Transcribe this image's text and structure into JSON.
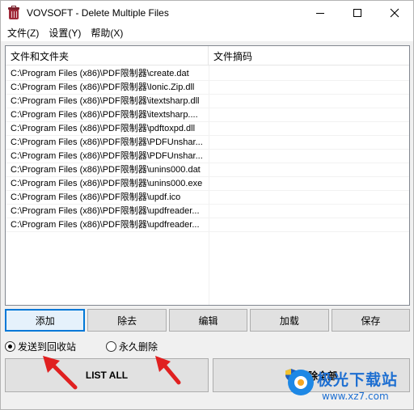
{
  "window": {
    "title": "VOVSOFT - Delete Multiple Files"
  },
  "menu": {
    "items": [
      "文件(Z)",
      "设置(Y)",
      "帮助(X)"
    ]
  },
  "list": {
    "columns": [
      "文件和文件夹",
      "文件摘码"
    ],
    "rows": [
      [
        "C:\\Program Files (x86)\\PDF限制器\\create.dat",
        ""
      ],
      [
        "C:\\Program Files (x86)\\PDF限制器\\Ionic.Zip.dll",
        ""
      ],
      [
        "C:\\Program Files (x86)\\PDF限制器\\itextsharp.dll",
        ""
      ],
      [
        "C:\\Program Files (x86)\\PDF限制器\\itextsharp....",
        ""
      ],
      [
        "C:\\Program Files (x86)\\PDF限制器\\pdftoxpd.dll",
        ""
      ],
      [
        "C:\\Program Files (x86)\\PDF限制器\\PDFUnshar...",
        ""
      ],
      [
        "C:\\Program Files (x86)\\PDF限制器\\PDFUnshar...",
        ""
      ],
      [
        "C:\\Program Files (x86)\\PDF限制器\\unins000.dat",
        ""
      ],
      [
        "C:\\Program Files (x86)\\PDF限制器\\unins000.exe",
        ""
      ],
      [
        "C:\\Program Files (x86)\\PDF限制器\\updf.ico",
        ""
      ],
      [
        "C:\\Program Files (x86)\\PDF限制器\\updfreader...",
        ""
      ],
      [
        "C:\\Program Files (x86)\\PDF限制器\\updfreader...",
        ""
      ]
    ]
  },
  "buttons": {
    "add": "添加",
    "remove": "除去",
    "edit": "编辑",
    "load": "加载",
    "save": "保存"
  },
  "options": {
    "recycle": "发送到回收站",
    "permanent": "永久删除",
    "selected": "recycle"
  },
  "actions": {
    "list_all": "LIST ALL",
    "delete_all": "删除全部"
  },
  "watermark": {
    "brand": "极光下载站",
    "url": "www.xz7.com"
  },
  "colors": {
    "accent": "#0078d7",
    "arrow": "#e02020",
    "watermark": "#1e6fd1"
  },
  "icons": {
    "app": "trash-can-icon",
    "shield": "uac-shield-icon"
  }
}
